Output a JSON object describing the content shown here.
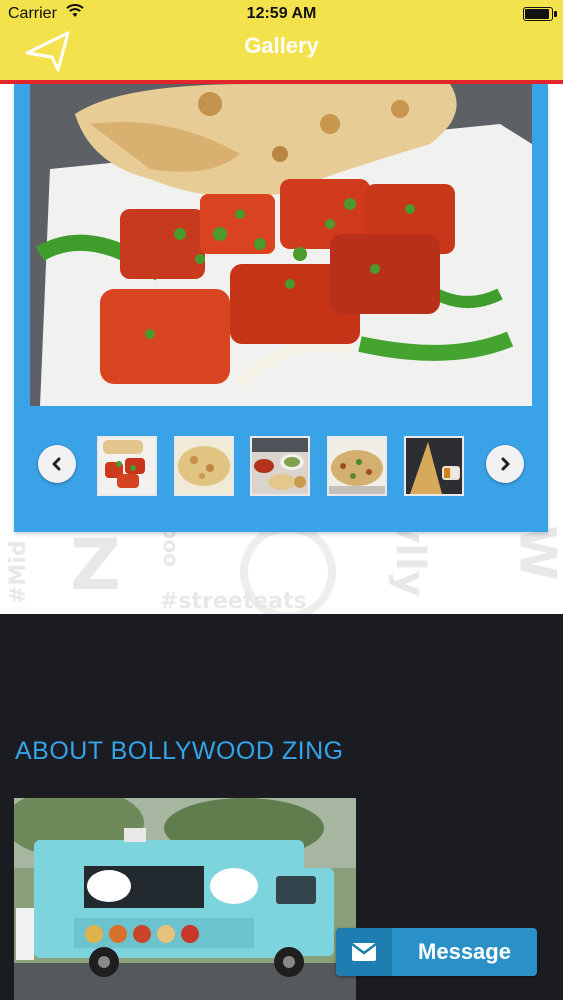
{
  "status_bar": {
    "carrier": "Carrier",
    "time": "12:59 AM"
  },
  "nav": {
    "title": "Gallery",
    "back_icon": "back-arrow-icon"
  },
  "colors": {
    "nav_bg": "#f3e24b",
    "nav_border": "#e3262b",
    "gallery_frame": "#3aa3e8",
    "dark_bg": "#1a1c22",
    "accent_text": "#36a3e8",
    "message_bg": "#2a90c8"
  },
  "gallery": {
    "prev_icon": "chevron-left-icon",
    "next_icon": "chevron-right-icon",
    "thumbnails": [
      "tandoori",
      "naan",
      "thali",
      "biryani",
      "dosa"
    ]
  },
  "about": {
    "title": "ABOUT BOLLYWOOD ZING"
  },
  "message_button": {
    "label": "Message",
    "icon": "envelope-icon"
  }
}
